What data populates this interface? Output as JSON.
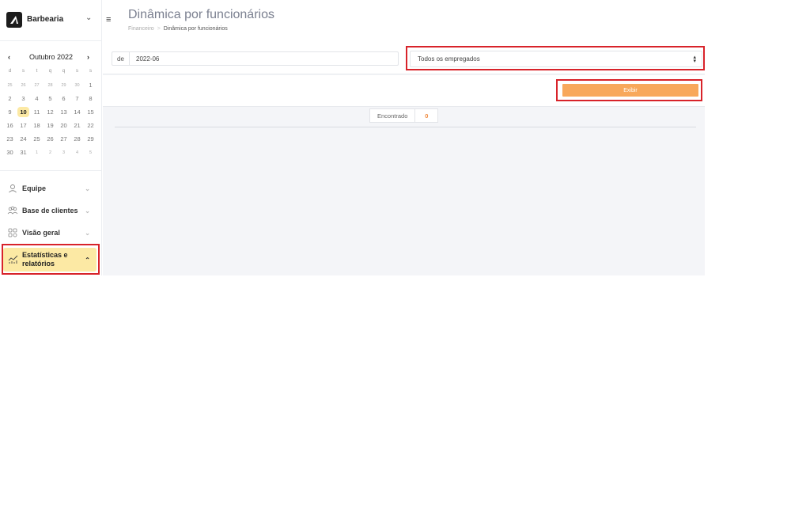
{
  "brand": {
    "name": "Barbearia"
  },
  "calendar": {
    "month_label": "Outubro 2022",
    "prev": "‹",
    "next": "›",
    "weekdays": [
      "d",
      "s",
      "t",
      "q",
      "q",
      "s",
      "s"
    ],
    "weeks": [
      [
        "25",
        "26",
        "27",
        "28",
        "29",
        "30",
        "1"
      ],
      [
        "2",
        "3",
        "4",
        "5",
        "6",
        "7",
        "8"
      ],
      [
        "9",
        "10",
        "11",
        "12",
        "13",
        "14",
        "15"
      ],
      [
        "16",
        "17",
        "18",
        "19",
        "20",
        "21",
        "22"
      ],
      [
        "23",
        "24",
        "25",
        "26",
        "27",
        "28",
        "29"
      ],
      [
        "30",
        "31",
        "1",
        "2",
        "3",
        "4",
        "5"
      ]
    ],
    "today": "10"
  },
  "nav": {
    "items": [
      {
        "label": "Equipe",
        "icon": "user-icon"
      },
      {
        "label": "Base de clientes",
        "icon": "users-icon"
      },
      {
        "label": "Visão geral",
        "icon": "grid-icon"
      },
      {
        "label": "Estatísticas e relatórios",
        "icon": "chart-icon",
        "active": true
      }
    ]
  },
  "header": {
    "title": "Dinâmica por funcionários",
    "breadcrumb": [
      "Financeiro",
      "Dinâmica por funcionários"
    ]
  },
  "filters": {
    "date_prefix": "de",
    "date_value": "2022-06",
    "employee_select": "Todos os empregados"
  },
  "actions": {
    "show_label": "Exibir"
  },
  "results": {
    "found_label": "Encontrado",
    "found_count": "0"
  },
  "colors": {
    "accent": "#f8a85b",
    "highlight": "#d8232a",
    "active_nav": "#fce9a4"
  }
}
